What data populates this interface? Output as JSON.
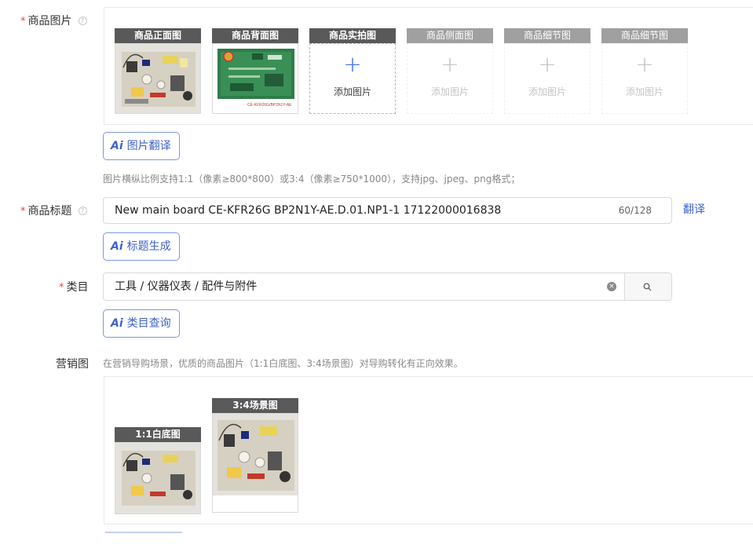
{
  "product_images": {
    "label": "商品图片",
    "help": "?",
    "slots": [
      {
        "caption": "商品正面图"
      },
      {
        "caption": "商品背面图",
        "board_text": "CE-KFR26G/BP2N1Y-AE"
      },
      {
        "caption": "商品实拍图",
        "add_text": "添加图片"
      },
      {
        "caption": "商品侧面图",
        "add_text": "添加图片"
      },
      {
        "caption": "商品细节图",
        "add_text": "添加图片"
      },
      {
        "caption": "商品细节图",
        "add_text": "添加图片"
      }
    ],
    "plus": "+",
    "ai_button": {
      "icon": "Ai",
      "label": "图片翻译"
    },
    "hint": "图片横纵比例支持1:1（像素≥800*800）或3:4（像素≥750*1000），支持jpg、jpeg、png格式；"
  },
  "product_title": {
    "label": "商品标题",
    "help": "?",
    "value": "New main board CE-KFR26G BP2N1Y-AE.D.01.NP1-1 17122000016838",
    "count": "60/128",
    "translate": "翻译",
    "ai_button": {
      "icon": "Ai",
      "label": "标题生成"
    }
  },
  "category": {
    "label": "类目",
    "value": "工具 / 仪器仪表 / 配件与附件",
    "clear": "×",
    "ai_button": {
      "icon": "Ai",
      "label": "类目查询"
    }
  },
  "marketing": {
    "label": "营销图",
    "hint": "在营销导购场景，优质的商品图片（1:1白底图、3:4场景图）对导购转化有正向效果。",
    "slots": [
      {
        "caption": "1:1白底图"
      },
      {
        "caption": "3:4场景图"
      }
    ]
  },
  "colors": {
    "required": "#f2462f",
    "link": "#3b62c8",
    "caption_bg": "#595959",
    "add_plus": "#3d6ee8"
  }
}
